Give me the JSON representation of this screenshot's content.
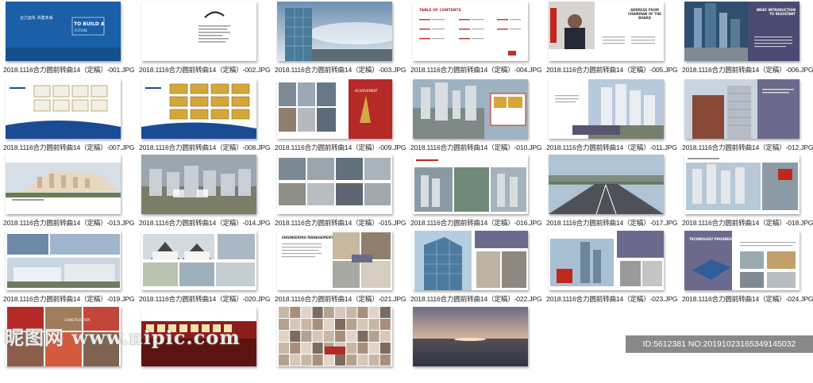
{
  "files": [
    {
      "name": "2018.1116合力圆前转曲14（定稿）-001.JPG",
      "style": "cover",
      "cover_title": "TO BUILD A",
      "cover_sub": "FUTURE"
    },
    {
      "name": "2018.1116合力圆前转曲14（定稿）-002.JPG",
      "style": "white"
    },
    {
      "name": "2018.1116合力圆前转曲14（定稿）-003.JPG",
      "style": "tower"
    },
    {
      "name": "2018.1116合力圆前转曲14（定稿）-004.JPG",
      "style": "toc",
      "toc_title": "TABLE OF CONTENTS"
    },
    {
      "name": "2018.1116合力圆前转曲14（定稿）-005.JPG",
      "style": "chairman",
      "heading": "ADDRESS FROM CHAIRMAN OF THE BOARD"
    },
    {
      "name": "2018.1116合力圆前转曲14（定稿）-006.JPG",
      "style": "intro",
      "heading": "BRIEF INTRODUCTION TO RESULTANT"
    },
    {
      "name": "2018.1116合力圆前转曲14（定稿）-007.JPG",
      "style": "certs"
    },
    {
      "name": "2018.1116合力圆前转曲14（定稿）-008.JPG",
      "style": "certs2"
    },
    {
      "name": "2018.1116合力圆前转曲14（定稿）-009.JPG",
      "style": "collage_red"
    },
    {
      "name": "2018.1116合力圆前转曲14（定稿）-010.JPG",
      "style": "aerial"
    },
    {
      "name": "2018.1116合力圆前转曲14（定稿）-011.JPG",
      "style": "white_bld"
    },
    {
      "name": "2018.1116合力圆前转曲14（定稿）-012.JPG",
      "style": "bld_purple"
    },
    {
      "name": "2018.1116合力圆前转曲14（定稿）-013.JPG",
      "style": "render"
    },
    {
      "name": "2018.1116合力圆前转曲14（定稿）-014.JPG",
      "style": "site"
    },
    {
      "name": "2018.1116合力圆前转曲14（定稿）-015.JPG",
      "style": "grid_photos"
    },
    {
      "name": "2018.1116合力圆前转曲14（定稿）-016.JPG",
      "style": "construction"
    },
    {
      "name": "2018.1116合力圆前转曲14（定稿）-017.JPG",
      "style": "road"
    },
    {
      "name": "2018.1116合力圆前转曲14（定稿）-018.JPG",
      "style": "towers_flag"
    },
    {
      "name": "2018.1116合力圆前转曲14（定稿）-019.JPG",
      "style": "factory"
    },
    {
      "name": "2018.1116合力圆前转曲14（定稿）-020.JPG",
      "style": "villas"
    },
    {
      "name": "2018.1116合力圆前转曲14（定稿）-021.JPG",
      "style": "eng_mgmt",
      "heading": "ENGINEERING MANAGEMENT"
    },
    {
      "name": "2018.1116合力圆前转曲14（定稿）-022.JPG",
      "style": "glass_tower"
    },
    {
      "name": "2018.1116合力圆前转曲14（定稿）-023.JPG",
      "style": "city_purple"
    },
    {
      "name": "2018.1116合力圆前转曲14（定稿）-024.JPG",
      "style": "tech",
      "heading": "TECHNOLOGY PROGRESS"
    },
    {
      "name": "",
      "style": "crowd"
    },
    {
      "name": "",
      "style": "banner_red"
    },
    {
      "name": "",
      "style": "faces"
    },
    {
      "name": "",
      "style": "sunset"
    }
  ],
  "watermark": {
    "logo": "昵图网 www.nipic.com",
    "id_text": "ID:5612381 NO:20191023165349145032"
  },
  "colors": {
    "cover_blue": "#1a5fa8",
    "accent_red": "#c0281e",
    "purple": "#6b6a8c",
    "sky": "#8fb0cc"
  }
}
